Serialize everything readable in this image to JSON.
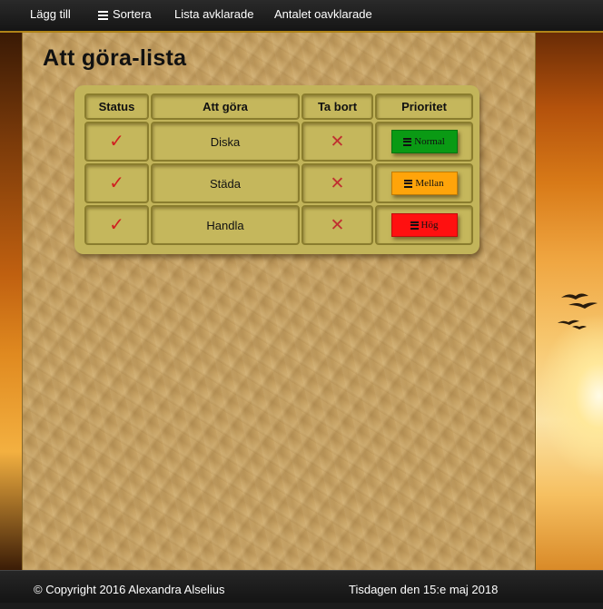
{
  "nav": {
    "add": "Lägg till",
    "sort": "Sortera",
    "cleared": "Lista avklarade",
    "count_uncleared": "Antalet oavklarade"
  },
  "title": "Att göra-lista",
  "table": {
    "headers": [
      "Status",
      "Att göra",
      "Ta bort",
      "Prioritet"
    ],
    "rows": [
      {
        "status": "✓",
        "task": "Diska",
        "remove": "✕",
        "priority": "Normal"
      },
      {
        "status": "✓",
        "task": "Städa",
        "remove": "✕",
        "priority": "Mellan"
      },
      {
        "status": "✓",
        "task": "Handla",
        "remove": "✕",
        "priority": "Hög"
      }
    ]
  },
  "priority_colors": {
    "Normal": "#0a9a14",
    "Mellan": "#ffa40a",
    "Hög": "#ff1010"
  },
  "icons": {
    "sort": "menu-icon",
    "status": "checkmark-icon",
    "remove": "cross-icon",
    "priority": "menu-icon"
  },
  "footer": {
    "copyright": "© Copyright 2016 Alexandra Alselius",
    "date": "Tisdagen den 15:e maj 2018"
  }
}
